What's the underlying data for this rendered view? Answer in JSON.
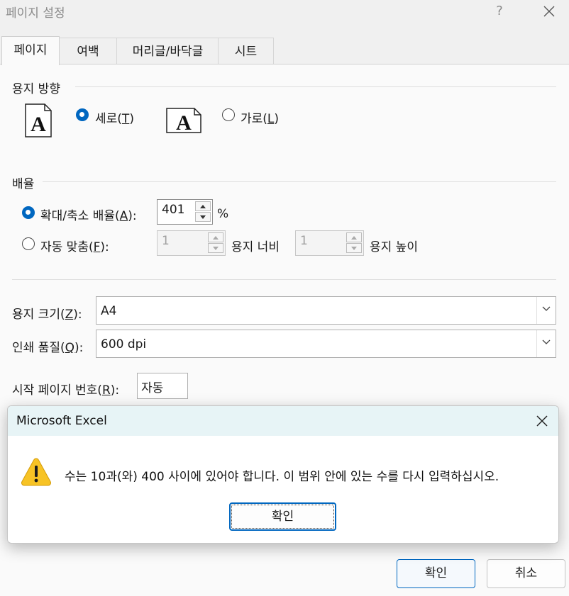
{
  "window": {
    "title": "페이지 설정",
    "help": "?"
  },
  "tabs": [
    {
      "label": "페이지",
      "active": true
    },
    {
      "label": "여백"
    },
    {
      "label": "머리글/바닥글"
    },
    {
      "label": "시트"
    }
  ],
  "orientation": {
    "section_label": "용지 방향",
    "portrait": {
      "label": "세로",
      "key": "T",
      "selected": true,
      "icon": "portrait-page-icon"
    },
    "landscape": {
      "label": "가로",
      "key": "L",
      "selected": false,
      "icon": "landscape-page-icon"
    }
  },
  "scaling": {
    "section_label": "배율",
    "adjust": {
      "label": "확대/축소 배율",
      "key": "A",
      "selected": true,
      "value": "401",
      "unit": "%"
    },
    "fit": {
      "label": "자동 맞춤",
      "key": "F",
      "selected": false,
      "wide_value": "1",
      "wide_label": "용지 너비",
      "tall_value": "1",
      "tall_label": "용지 높이"
    }
  },
  "paper_size": {
    "label": "용지 크기",
    "key": "Z",
    "value": "A4"
  },
  "print_quality": {
    "label": "인쇄 품질",
    "key": "Q",
    "value": "600 dpi"
  },
  "first_page": {
    "label": "시작 페이지 번호",
    "key": "R",
    "value": "자동"
  },
  "message_box": {
    "title": "Microsoft Excel",
    "icon": "warning-icon",
    "text": "수는 10과(와) 400 사이에 있어야 합니다. 이 범위 안에 있는 수를 다시 입력하십시오.",
    "ok_label": "확인"
  },
  "footer": {
    "ok_label": "확인",
    "cancel_label": "취소"
  },
  "colors": {
    "accent": "#0067c0",
    "msg_titlebar": "#e7f4f6",
    "warning": "#f7c325"
  }
}
